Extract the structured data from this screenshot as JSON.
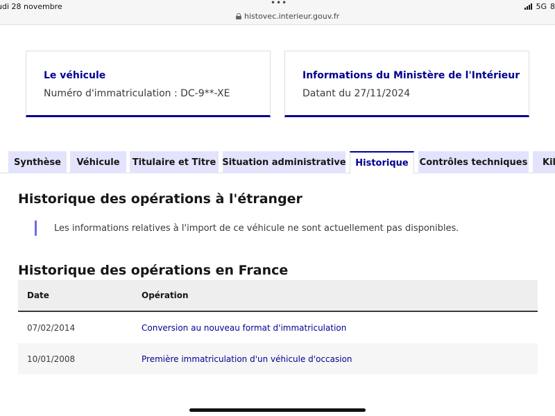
{
  "statusbar": {
    "date": "udi 28 novembre",
    "dots": "•••",
    "url": "histovec.interieur.gouv.fr",
    "network": "5G",
    "battery_fragment": "8"
  },
  "cards": {
    "vehicle": {
      "title": "Le véhicule",
      "text": "Numéro d'immatriculation : DC-9**-XE"
    },
    "ministry": {
      "title": "Informations du Ministère de l'Intérieur",
      "text": "Datant du 27/11/2024"
    }
  },
  "tabs": [
    {
      "label": "Synthèse"
    },
    {
      "label": "Véhicule"
    },
    {
      "label": "Titulaire et Titre"
    },
    {
      "label": "Situation administrative"
    },
    {
      "label": "Historique",
      "active": true
    },
    {
      "label": "Contrôles techniques"
    },
    {
      "label": "Kilo"
    }
  ],
  "foreign": {
    "title": "Historique des opérations à l'étranger",
    "notice": "Les informations relatives à l'import de ce véhicule ne sont actuellement pas disponibles."
  },
  "france": {
    "title": "Historique des opérations en France",
    "columns": {
      "date": "Date",
      "operation": "Opération"
    },
    "rows": [
      {
        "date": "07/02/2014",
        "operation": "Conversion au nouveau format d'immatriculation"
      },
      {
        "date": "10/01/2008",
        "operation": "Première immatriculation d'un véhicule d'occasion"
      }
    ]
  },
  "colors": {
    "primary": "#000091",
    "tab_bg": "#e3e3fd",
    "notice_bar": "#6a6af4"
  }
}
